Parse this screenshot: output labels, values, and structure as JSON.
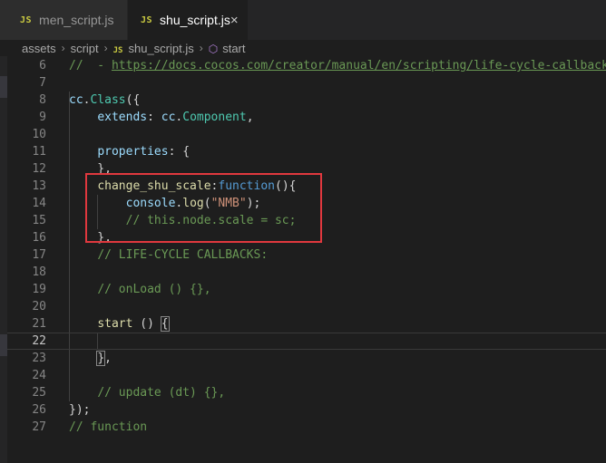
{
  "tabs": [
    {
      "badge": "JS",
      "label": "men_script.js",
      "active": false
    },
    {
      "badge": "JS",
      "label": "shu_script.js",
      "active": true,
      "close": "×"
    }
  ],
  "breadcrumb": {
    "items": [
      "assets",
      "script"
    ],
    "file": "shu_script.js",
    "file_badge": "JS",
    "symbol": "start",
    "separator": "›"
  },
  "editor": {
    "current_line": 22,
    "lines": [
      {
        "n": 6,
        "tokens": [
          [
            "cm",
            "//  - "
          ],
          [
            "link",
            "https://docs.cocos.com/creator/manual/en/scripting/life-cycle-callbacks"
          ]
        ]
      },
      {
        "n": 7,
        "tokens": []
      },
      {
        "n": 8,
        "tokens": [
          [
            "prop",
            "cc"
          ],
          [
            "",
            "."
          ],
          [
            "type",
            "Class"
          ],
          [
            "",
            "({"
          ]
        ]
      },
      {
        "n": 9,
        "tokens": [
          [
            "",
            "    "
          ],
          [
            "prop",
            "extends"
          ],
          [
            "",
            ": "
          ],
          [
            "prop",
            "cc"
          ],
          [
            "",
            "."
          ],
          [
            "type",
            "Component"
          ],
          [
            "",
            ","
          ]
        ]
      },
      {
        "n": 10,
        "tokens": []
      },
      {
        "n": 11,
        "tokens": [
          [
            "",
            "    "
          ],
          [
            "prop",
            "properties"
          ],
          [
            "",
            ": {"
          ]
        ]
      },
      {
        "n": 12,
        "tokens": [
          [
            "",
            "    },"
          ]
        ]
      },
      {
        "n": 13,
        "tokens": [
          [
            "",
            "    "
          ],
          [
            "fn",
            "change_shu_scale"
          ],
          [
            "",
            ":"
          ],
          [
            "kw",
            "function"
          ],
          [
            "",
            "(){"
          ]
        ]
      },
      {
        "n": 14,
        "tokens": [
          [
            "",
            "        "
          ],
          [
            "prop",
            "console"
          ],
          [
            "",
            "."
          ],
          [
            "fn",
            "log"
          ],
          [
            "",
            "("
          ],
          [
            "str",
            "\"NMB\""
          ],
          [
            "",
            ");"
          ]
        ]
      },
      {
        "n": 15,
        "tokens": [
          [
            "",
            "        "
          ],
          [
            "cm",
            "// this.node.scale = sc;"
          ]
        ]
      },
      {
        "n": 16,
        "tokens": [
          [
            "",
            "    },"
          ]
        ]
      },
      {
        "n": 17,
        "tokens": [
          [
            "",
            "    "
          ],
          [
            "cm",
            "// LIFE-CYCLE CALLBACKS:"
          ]
        ]
      },
      {
        "n": 18,
        "tokens": []
      },
      {
        "n": 19,
        "tokens": [
          [
            "",
            "    "
          ],
          [
            "cm",
            "// onLoad () {},"
          ]
        ]
      },
      {
        "n": 20,
        "tokens": []
      },
      {
        "n": 21,
        "tokens": [
          [
            "",
            "    "
          ],
          [
            "fn",
            "start"
          ],
          [
            "",
            " () "
          ],
          [
            "box",
            "{"
          ]
        ]
      },
      {
        "n": 22,
        "tokens": []
      },
      {
        "n": 23,
        "tokens": [
          [
            "",
            "    "
          ],
          [
            "box",
            "}"
          ],
          [
            "",
            ","
          ]
        ]
      },
      {
        "n": 24,
        "tokens": []
      },
      {
        "n": 25,
        "tokens": [
          [
            "",
            "    "
          ],
          [
            "cm",
            "// update (dt) {},"
          ]
        ]
      },
      {
        "n": 26,
        "tokens": [
          [
            "",
            "});"
          ]
        ]
      },
      {
        "n": 27,
        "tokens": [
          [
            "cm",
            "// function"
          ]
        ]
      }
    ]
  },
  "colors": {
    "annotation_box": "#e0383e",
    "editor_bg": "#1e1e1e",
    "tabbar_bg": "#252526"
  }
}
